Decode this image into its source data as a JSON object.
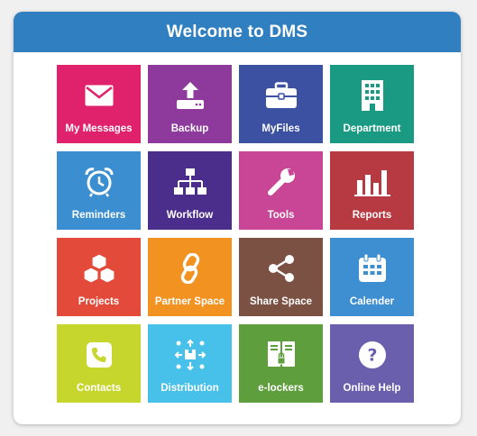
{
  "header": {
    "title": "Welcome to DMS"
  },
  "tiles": [
    {
      "label": "My Messages",
      "icon": "envelope-icon",
      "color": "#e0216b"
    },
    {
      "label": "Backup",
      "icon": "upload-drive-icon",
      "color": "#8e3a9d"
    },
    {
      "label": "MyFiles",
      "icon": "briefcase-icon",
      "color": "#3c51a2"
    },
    {
      "label": "Department",
      "icon": "building-icon",
      "color": "#1a9a82"
    },
    {
      "label": "Reminders",
      "icon": "alarm-clock-icon",
      "color": "#3b8fd0"
    },
    {
      "label": "Workflow",
      "icon": "org-chart-icon",
      "color": "#4b2d8b"
    },
    {
      "label": "Tools",
      "icon": "wrench-icon",
      "color": "#c94595"
    },
    {
      "label": "Reports",
      "icon": "bar-chart-icon",
      "color": "#b73a42"
    },
    {
      "label": "Projects",
      "icon": "cubes-icon",
      "color": "#e34a3a"
    },
    {
      "label": "Partner Space",
      "icon": "link-icon",
      "color": "#f29220"
    },
    {
      "label": "Share Space",
      "icon": "share-icon",
      "color": "#7a5142"
    },
    {
      "label": "Calender",
      "icon": "calendar-icon",
      "color": "#3d8fd2"
    },
    {
      "label": "Contacts",
      "icon": "phone-icon",
      "color": "#c6d62c"
    },
    {
      "label": "Distribution",
      "icon": "distribution-icon",
      "color": "#47c1ea"
    },
    {
      "label": "e-lockers",
      "icon": "lockers-icon",
      "color": "#5e9e3c"
    },
    {
      "label": "Online Help",
      "icon": "help-icon",
      "color": "#6a5fad"
    }
  ]
}
